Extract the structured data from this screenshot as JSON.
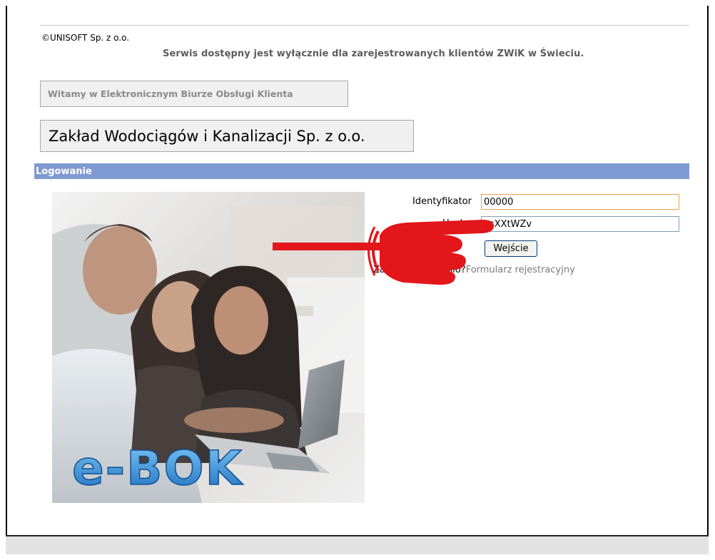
{
  "header": {
    "copyright": "©UNISOFT Sp. z o.o.",
    "notice": "Serwis dostępny jest wyłącznie dla zarejestrowanych klientów ZWiK w Świeciu."
  },
  "welcome": "Witamy w Elektronicznym Biurze Obsługi Klienta",
  "company": "Zakład Wodociągów i Kanalizacji Sp. z o.o.",
  "login": {
    "section_title": "Logowanie",
    "identifier_label": "Identyfikator",
    "identifier_value": "00000",
    "password_label": "Hasło",
    "password_value": "asXXtWZv",
    "submit_label": "Wejście",
    "forgot_link": "Zapomniałeś hasło?",
    "register_link": "Formularz rejestracyjny"
  },
  "image": {
    "brand_text": "e-BOK"
  },
  "colors": {
    "section_bar": "#7f9ad2",
    "pointer_red": "#e3161b",
    "identifier_border": "#e6a24a",
    "password_border": "#7f9db9"
  }
}
